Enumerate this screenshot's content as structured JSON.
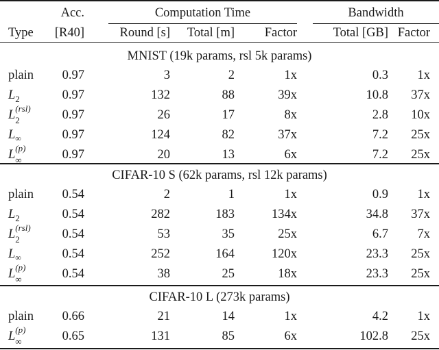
{
  "header": {
    "row1": {
      "acc": "Acc.",
      "computation_time": "Computation Time",
      "bandwidth": "Bandwidth"
    },
    "row2": {
      "type": "Type",
      "acc_unit": "[R40]",
      "round": "Round [s]",
      "total_m": "Total [m]",
      "factor_ct": "Factor",
      "total_gb": "Total [GB]",
      "factor_bw": "Factor"
    }
  },
  "sections": [
    {
      "title": "MNIST (19k params, rsl 5k params)",
      "rows": [
        {
          "type": "plain",
          "acc": "0.97",
          "round": "3",
          "total": "2",
          "factor": "1x",
          "bw_total": "0.3",
          "bw_factor": "1x"
        },
        {
          "type": "L2",
          "acc": "0.97",
          "round": "132",
          "total": "88",
          "factor": "39x",
          "bw_total": "10.8",
          "bw_factor": "37x"
        },
        {
          "type": "L2(rsl)",
          "acc": "0.97",
          "round": "26",
          "total": "17",
          "factor": "8x",
          "bw_total": "2.8",
          "bw_factor": "10x"
        },
        {
          "type": "Linf",
          "acc": "0.97",
          "round": "124",
          "total": "82",
          "factor": "37x",
          "bw_total": "7.2",
          "bw_factor": "25x"
        },
        {
          "type": "Linf(p)",
          "acc": "0.97",
          "round": "20",
          "total": "13",
          "factor": "6x",
          "bw_total": "7.2",
          "bw_factor": "25x"
        }
      ]
    },
    {
      "title": "CIFAR-10 S (62k params, rsl 12k params)",
      "rows": [
        {
          "type": "plain",
          "acc": "0.54",
          "round": "2",
          "total": "1",
          "factor": "1x",
          "bw_total": "0.9",
          "bw_factor": "1x"
        },
        {
          "type": "L2",
          "acc": "0.54",
          "round": "282",
          "total": "183",
          "factor": "134x",
          "bw_total": "34.8",
          "bw_factor": "37x"
        },
        {
          "type": "L2(rsl)",
          "acc": "0.54",
          "round": "53",
          "total": "35",
          "factor": "25x",
          "bw_total": "6.7",
          "bw_factor": "7x"
        },
        {
          "type": "Linf",
          "acc": "0.54",
          "round": "252",
          "total": "164",
          "factor": "120x",
          "bw_total": "23.3",
          "bw_factor": "25x"
        },
        {
          "type": "Linf(p)",
          "acc": "0.54",
          "round": "38",
          "total": "25",
          "factor": "18x",
          "bw_total": "23.3",
          "bw_factor": "25x"
        }
      ]
    },
    {
      "title": "CIFAR-10 L (273k params)",
      "rows": [
        {
          "type": "plain",
          "acc": "0.66",
          "round": "21",
          "total": "14",
          "factor": "1x",
          "bw_total": "4.2",
          "bw_factor": "1x"
        },
        {
          "type": "Linf(p)",
          "acc": "0.65",
          "round": "131",
          "total": "85",
          "factor": "6x",
          "bw_total": "102.8",
          "bw_factor": "25x"
        }
      ]
    }
  ],
  "type_labels": {
    "plain": "plain",
    "L": "L",
    "sub2": "2",
    "inf": "∞",
    "rsl": "(rsl)",
    "p": "(p)"
  }
}
